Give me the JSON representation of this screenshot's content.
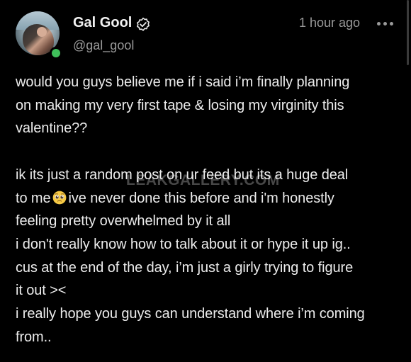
{
  "post": {
    "author": {
      "name": "Gal Gool",
      "handle": "@gal_gool",
      "verified_icon": "verified-badge-icon",
      "online": true,
      "online_color": "#3fbf5a"
    },
    "timestamp": "1 hour ago",
    "more_icon": "more-horizontal-icon",
    "paragraph1": [
      "would you guys believe me if i said i’m finally planning",
      "on making my very first tape & losing my virginity this",
      "valentine??"
    ],
    "paragraph2": {
      "line1": "ik its just a random post on ur feed but its a huge deal",
      "line2_before_emoji": "to me",
      "emoji": "pleading-face-emoji",
      "line2_after_emoji": "ive never done this before and i'm honestly",
      "line3": "feeling pretty overwhelmed by it all",
      "line4": "i don't really know how to talk about it or hype it up ig..",
      "line5": "cus at the end of the day, i’m just a girly trying to figure",
      "line6": "it out ><",
      "line7": "i really hope you guys can understand where i’m coming",
      "line8": "from.."
    }
  },
  "watermark": "LEAKGALLERY.COM",
  "colors": {
    "background": "#000000",
    "text": "#ececec",
    "muted": "#9a9a9a"
  }
}
